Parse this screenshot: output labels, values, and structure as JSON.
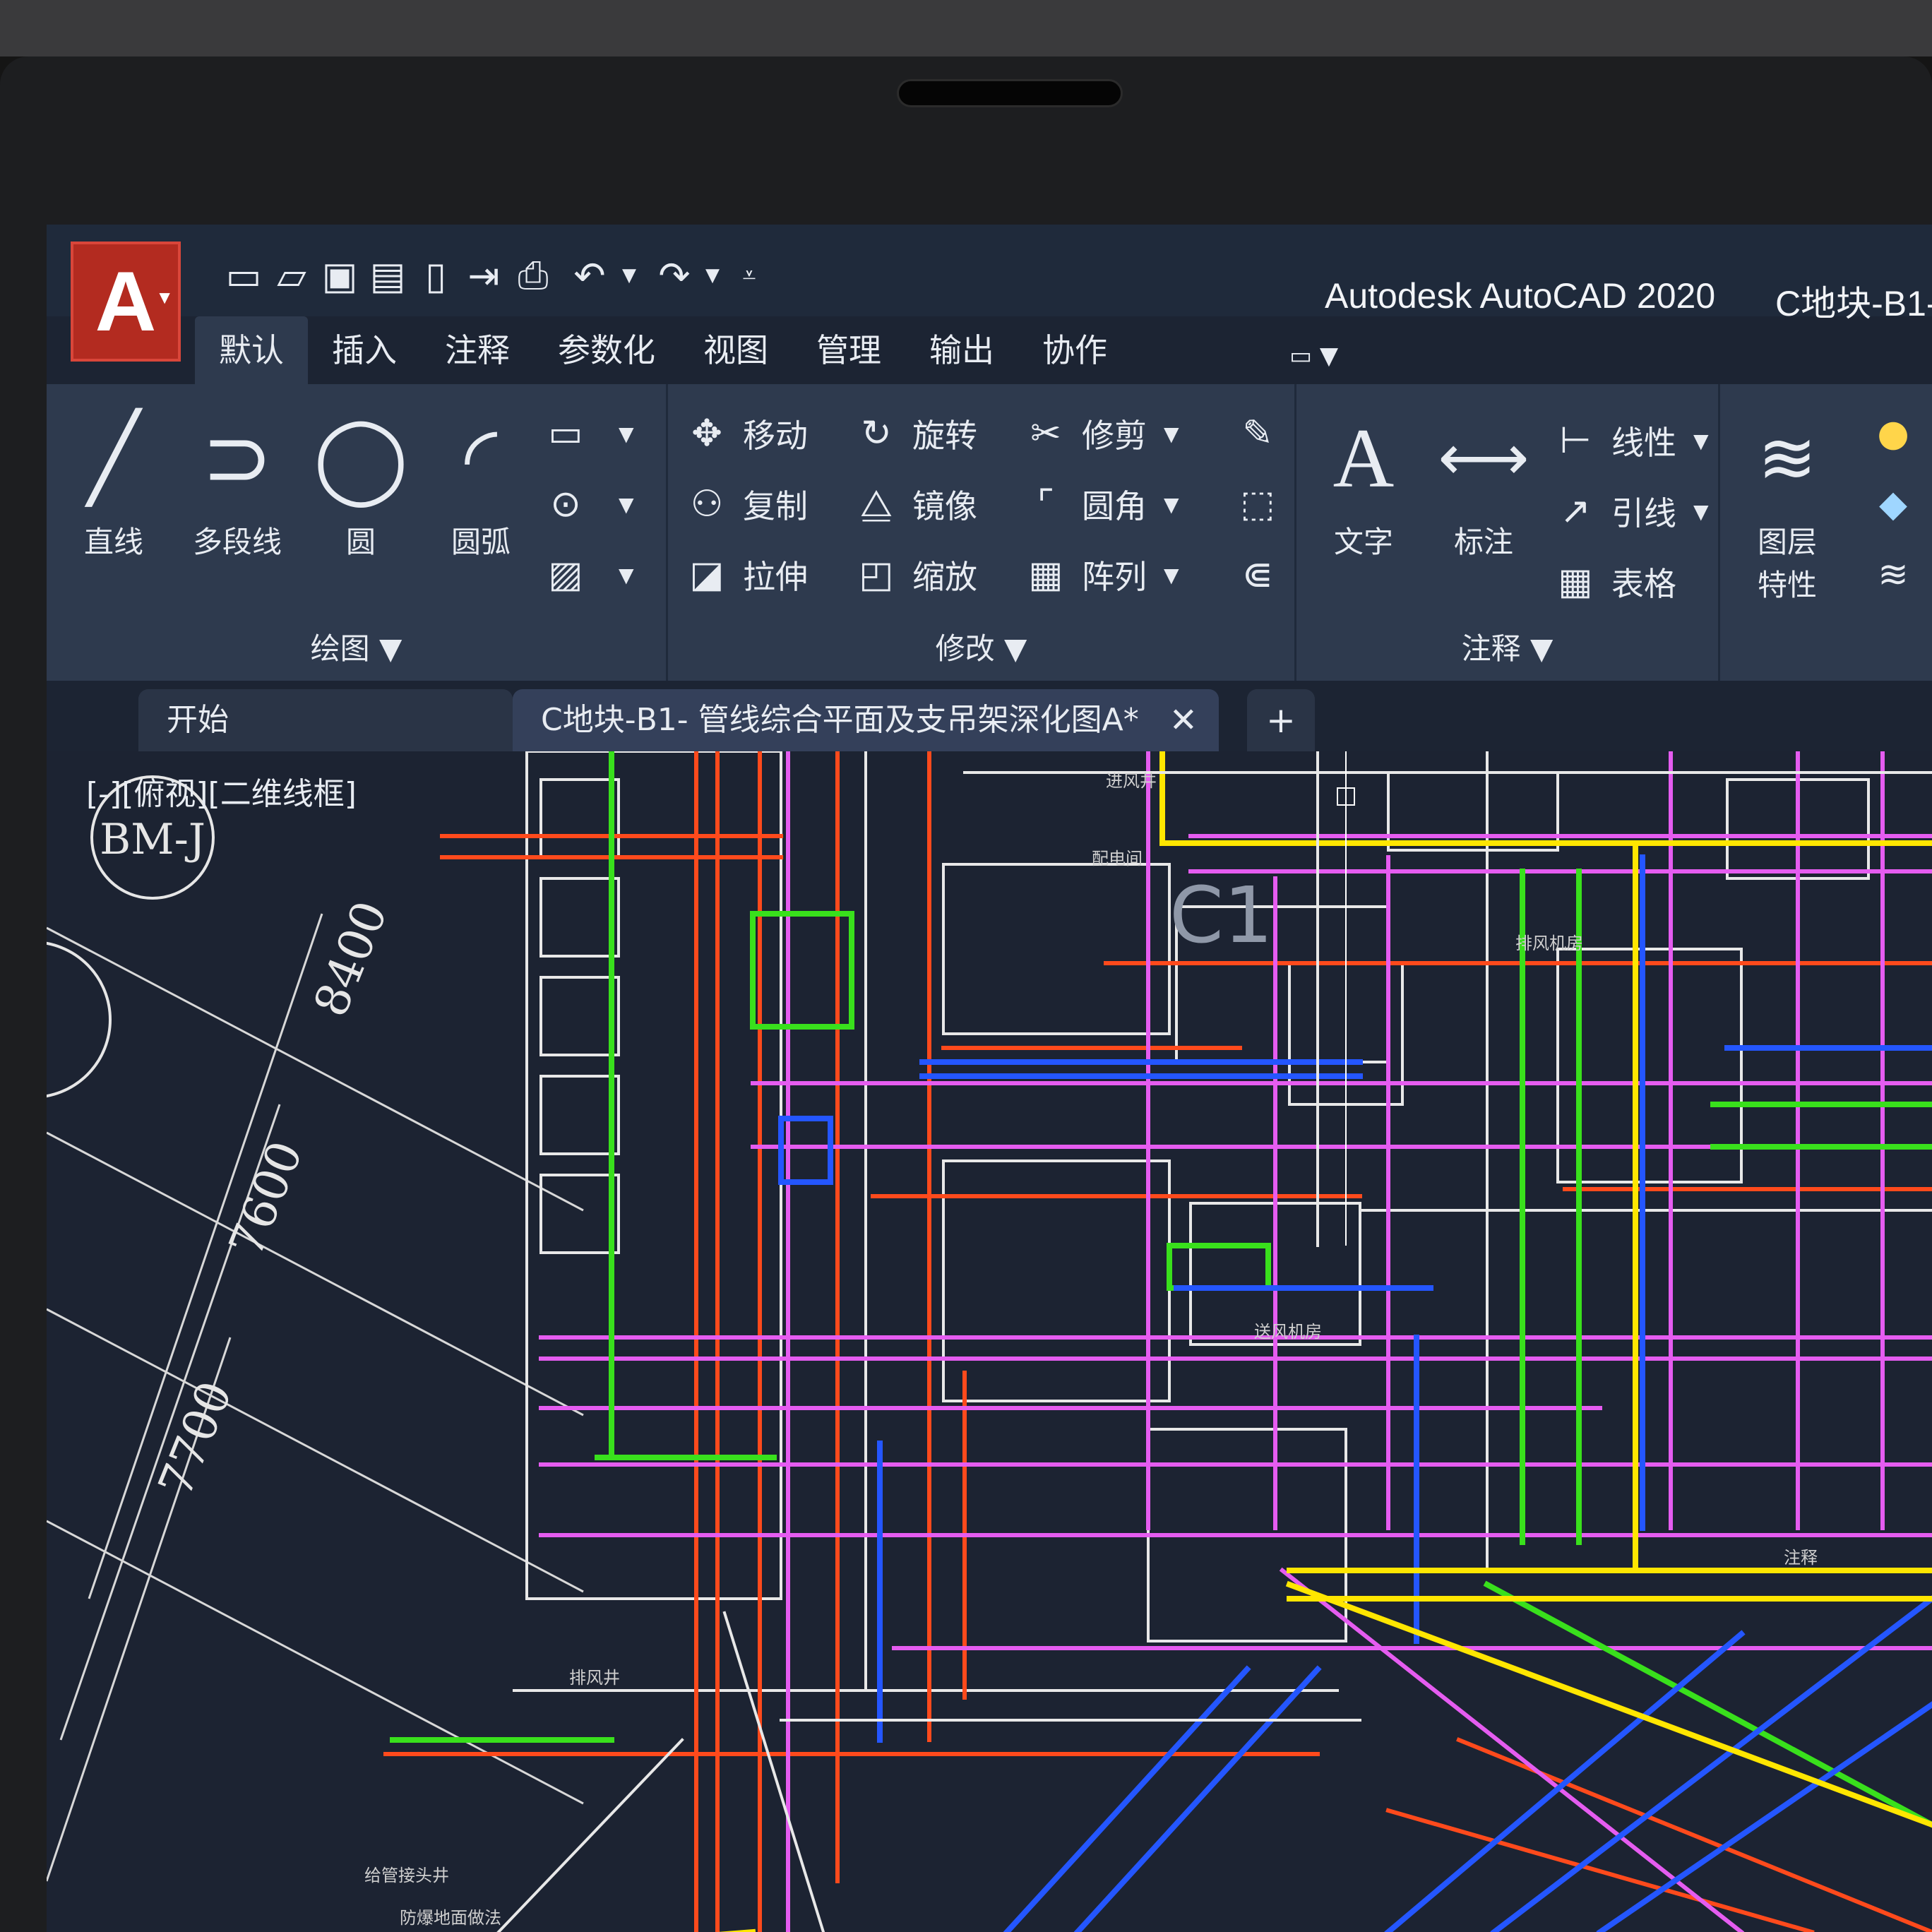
{
  "titlebar": {
    "app_title": "Autodesk AutoCAD 2020",
    "doc_title_truncated": "C地块-B1-"
  },
  "ribbon_tabs": [
    "默认",
    "插入",
    "注释",
    "参数化",
    "视图",
    "管理",
    "输出",
    "协作"
  ],
  "ribbon": {
    "draw": {
      "title": "绘图",
      "line": "直线",
      "polyline": "多段线",
      "circle": "圆",
      "arc": "圆弧"
    },
    "modify": {
      "title": "修改",
      "move": "移动",
      "rotate": "旋转",
      "trim": "修剪",
      "copy": "复制",
      "mirror": "镜像",
      "fillet": "圆角",
      "stretch": "拉伸",
      "scale": "缩放",
      "array": "阵列"
    },
    "annotation": {
      "title": "注释",
      "text": "文字",
      "dimension": "标注",
      "linear": "线性",
      "leader": "引线",
      "table": "表格"
    },
    "layers": {
      "layer_properties_line1": "图层",
      "layer_properties_line2": "特性"
    }
  },
  "file_tabs": {
    "start": "开始",
    "document": "C地块-B1- 管线综合平面及支吊架深化图A*",
    "close_glyph": "✕",
    "new_glyph": "+"
  },
  "viewport": {
    "label": "[-][俯视][二维线框]"
  },
  "drawing": {
    "grid_tag": "BM-J",
    "dims": [
      "8400",
      "7600",
      "7700"
    ],
    "room_labels": [
      "进风井",
      "配电间",
      "送风机房",
      "注释",
      "排风机房",
      "给管接头井",
      "防爆地面做法",
      "排风井"
    ],
    "column_tag": "C1"
  },
  "colors": {
    "ui_dark": "#1f2a3b",
    "ribbon": "#2e3a4e",
    "canvas": "#1c2332",
    "pipe_orange": "#ff4a1c",
    "pipe_magenta": "#e55cf0",
    "pipe_green": "#39e01c",
    "pipe_blue": "#2456ff",
    "pipe_yellow": "#ffe600",
    "wall_white": "#e8e8e8"
  }
}
